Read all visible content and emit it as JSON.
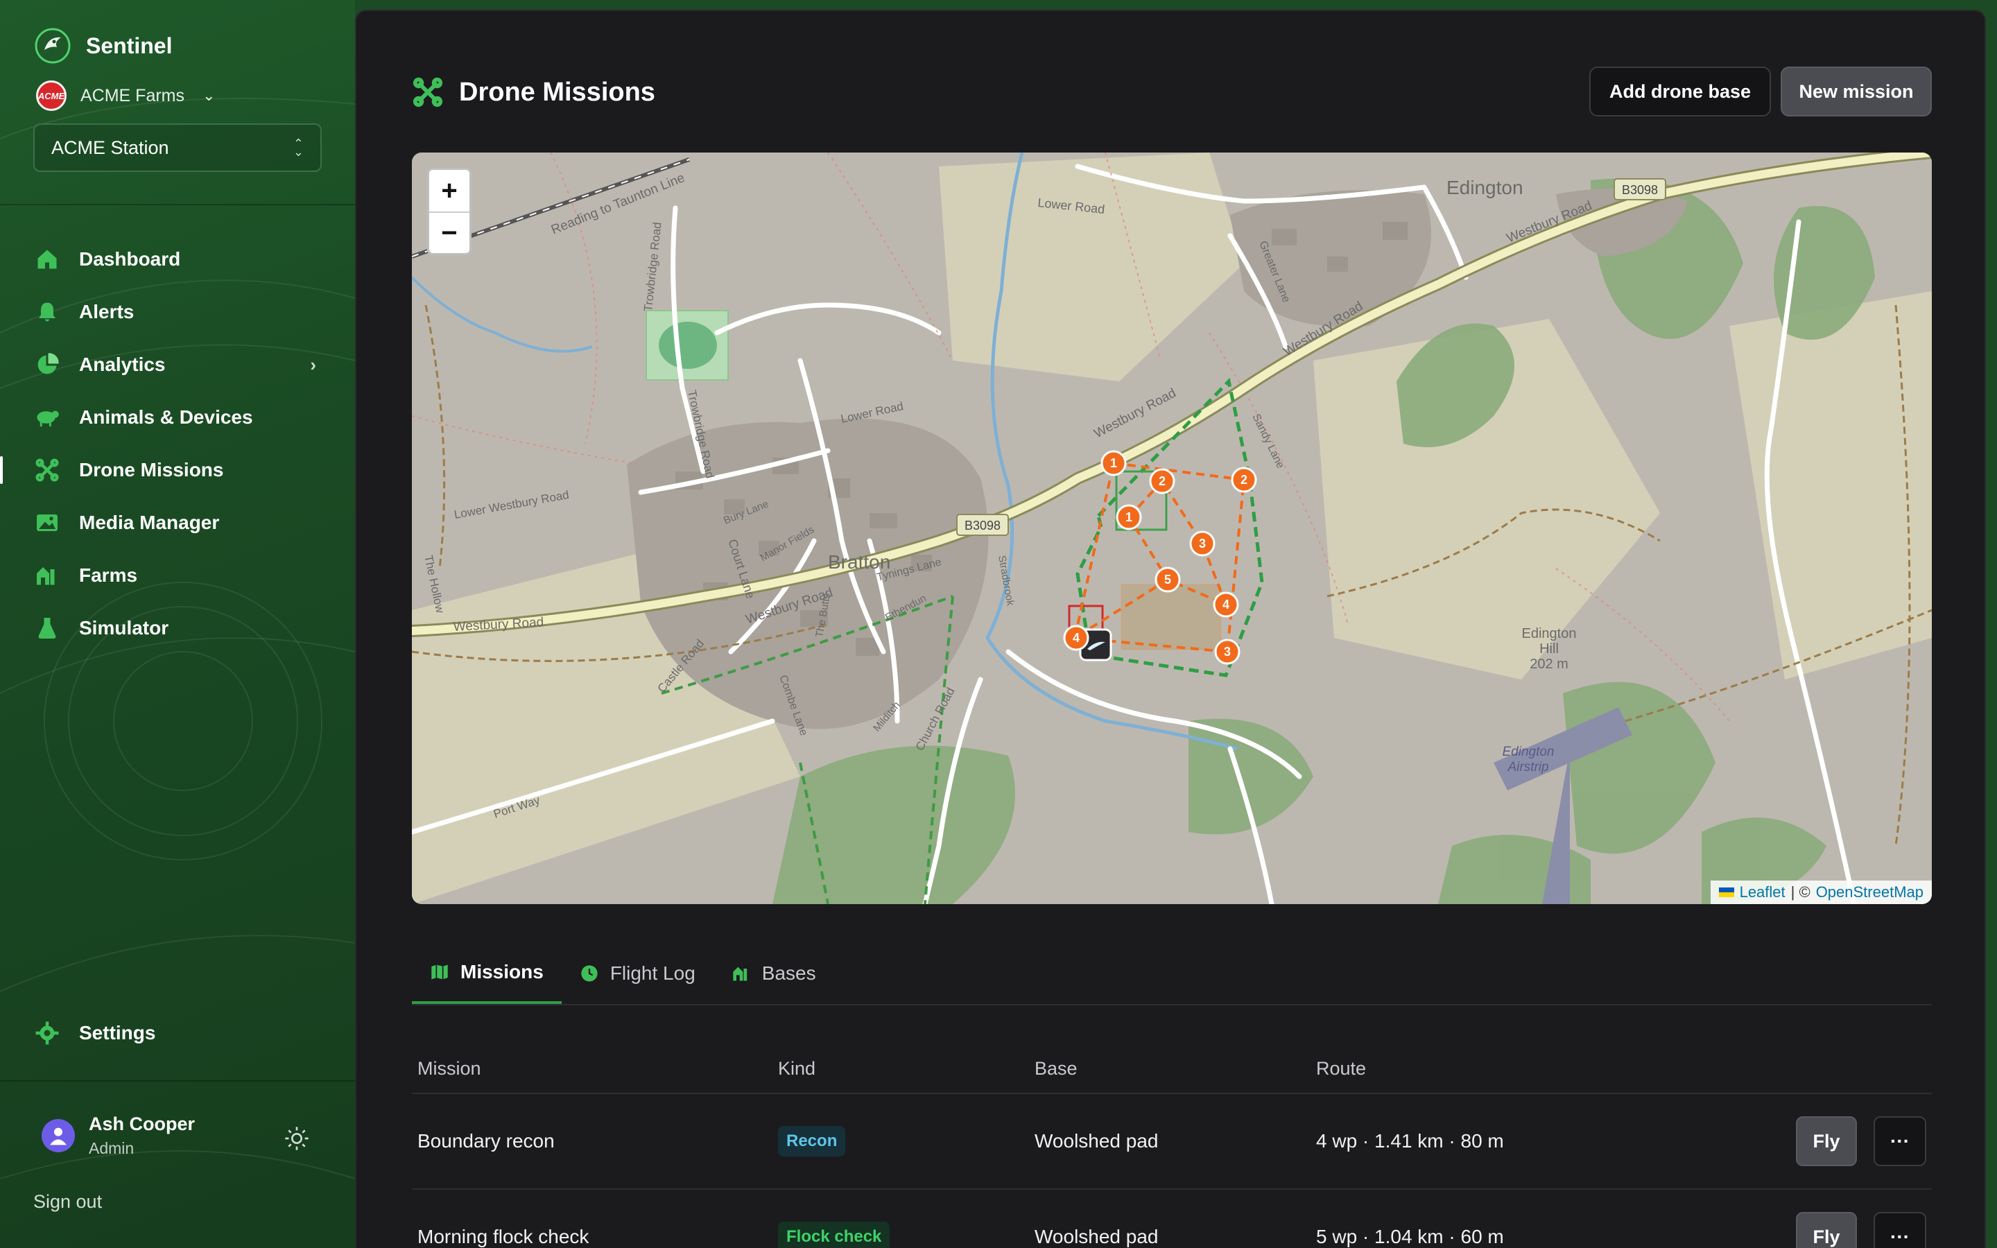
{
  "app": {
    "name": "Sentinel"
  },
  "org": {
    "name": "ACME Farms",
    "logo_text": "ACME"
  },
  "station": {
    "selected": "ACME Station"
  },
  "nav": {
    "items": [
      {
        "label": "Dashboard",
        "icon": "home-icon"
      },
      {
        "label": "Alerts",
        "icon": "bell-icon"
      },
      {
        "label": "Analytics",
        "icon": "pie-chart-icon"
      },
      {
        "label": "Animals & Devices",
        "icon": "sheep-icon"
      },
      {
        "label": "Drone Missions",
        "icon": "drone-icon"
      },
      {
        "label": "Media Manager",
        "icon": "image-icon"
      },
      {
        "label": "Farms",
        "icon": "barn-icon"
      },
      {
        "label": "Simulator",
        "icon": "flask-icon"
      }
    ],
    "settings_label": "Settings"
  },
  "user": {
    "name": "Ash Cooper",
    "role": "Admin"
  },
  "signout_label": "Sign out",
  "page": {
    "title": "Drone Missions",
    "add_base_label": "Add drone base",
    "new_mission_label": "New mission"
  },
  "map": {
    "zoom_in": "+",
    "zoom_out": "−",
    "attribution_leaflet": "Leaflet",
    "attribution_sep": "| ©",
    "attribution_osm": "OpenStreetMap",
    "labels": {
      "edington": "Edington",
      "bratton": "Bratton",
      "b3098_a": "B3098",
      "b3098_b": "B3098",
      "westbury_road_a": "Westbury Road",
      "westbury_road_b": "Westbury Road",
      "westbury_road_c": "Westbury Road",
      "westbury_road_d": "Westbury Road",
      "westbury_road_e": "Westbury Road",
      "lower_road": "Lower Road",
      "lower_road_b": "Lower Road",
      "reading_line": "Reading to Taunton Line",
      "trowbridge_road": "Trowbridge Road",
      "trowbridge_road_b": "Trowbridge Road",
      "lower_westbury_road": "Lower Westbury Road",
      "court_lane": "Court Lane",
      "castle_road": "Castle Road",
      "the_hollow": "The Hollow",
      "port_way": "Port Way",
      "church_road": "Church Road",
      "combe_lane": "Combe Lane",
      "greater_lane": "Greater Lane",
      "sandy_lane": "Sandy Lane",
      "edington_hill": "Edington",
      "edington_hill2": "Hill",
      "edington_hill3": "202 m",
      "edington_airstrip": "Edington",
      "edington_airstrip2": "Airstrip",
      "tynings_lane": "Tynings Lane",
      "manor_fields": "Manor Fields",
      "bury_lane": "Bury Lane",
      "the_butts": "The Butts",
      "ethendun": "Ethendun",
      "milditch": "Milditch",
      "stradbrook": "Stradbrook"
    },
    "waypoints_a": [
      "1",
      "2",
      "3",
      "4"
    ],
    "waypoints_b": [
      "1",
      "2",
      "3",
      "4",
      "5"
    ]
  },
  "tabs": [
    {
      "label": "Missions",
      "icon": "map-icon"
    },
    {
      "label": "Flight Log",
      "icon": "clock-icon"
    },
    {
      "label": "Bases",
      "icon": "barn-icon"
    }
  ],
  "table": {
    "headers": [
      "Mission",
      "Kind",
      "Base",
      "Route"
    ],
    "rows": [
      {
        "mission": "Boundary recon",
        "kind": "Recon",
        "base": "Woolshed pad",
        "route": "4 wp · 1.41 km · 80 m",
        "fly": "Fly",
        "more": "···"
      },
      {
        "mission": "Morning flock check",
        "kind": "Flock check",
        "base": "Woolshed pad",
        "route": "5 wp · 1.04 km · 60 m",
        "fly": "Fly",
        "more": "···"
      }
    ]
  },
  "colors": {
    "accent": "#2e9e45",
    "waypoint": "#f26a1b",
    "sidebar": "#1b4a24",
    "main_bg": "#1b1b1e"
  }
}
